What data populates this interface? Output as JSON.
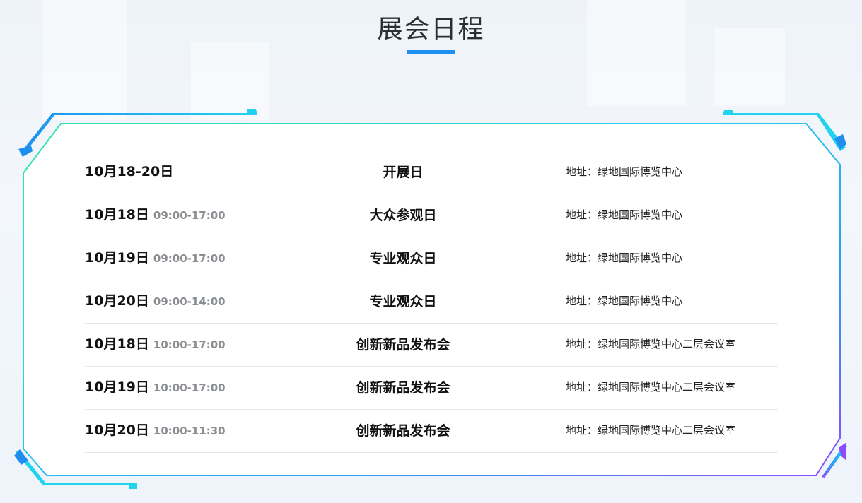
{
  "page_title": "展会日程",
  "colors": {
    "accent": "#1e8ff0",
    "frame_gradient_start": "#2ee6a8",
    "frame_gradient_mid": "#1fb6ff",
    "frame_gradient_end": "#8a4cff"
  },
  "schedule": [
    {
      "date": "10月18-20日",
      "time": "",
      "event": "开展日",
      "address": "地址：绿地国际博览中心"
    },
    {
      "date": "10月18日",
      "time": "09:00-17:00",
      "event": "大众参观日",
      "address": "地址：绿地国际博览中心"
    },
    {
      "date": "10月19日",
      "time": "09:00-17:00",
      "event": "专业观众日",
      "address": "地址：绿地国际博览中心"
    },
    {
      "date": "10月20日",
      "time": "09:00-14:00",
      "event": "专业观众日",
      "address": "地址：绿地国际博览中心"
    },
    {
      "date": "10月18日",
      "time": "10:00-17:00",
      "event": "创新新品发布会",
      "address": "地址：绿地国际博览中心二层会议室"
    },
    {
      "date": "10月19日",
      "time": "10:00-17:00",
      "event": "创新新品发布会",
      "address": "地址：绿地国际博览中心二层会议室"
    },
    {
      "date": "10月20日",
      "time": "10:00-11:30",
      "event": "创新新品发布会",
      "address": "地址：绿地国际博览中心二层会议室"
    }
  ]
}
